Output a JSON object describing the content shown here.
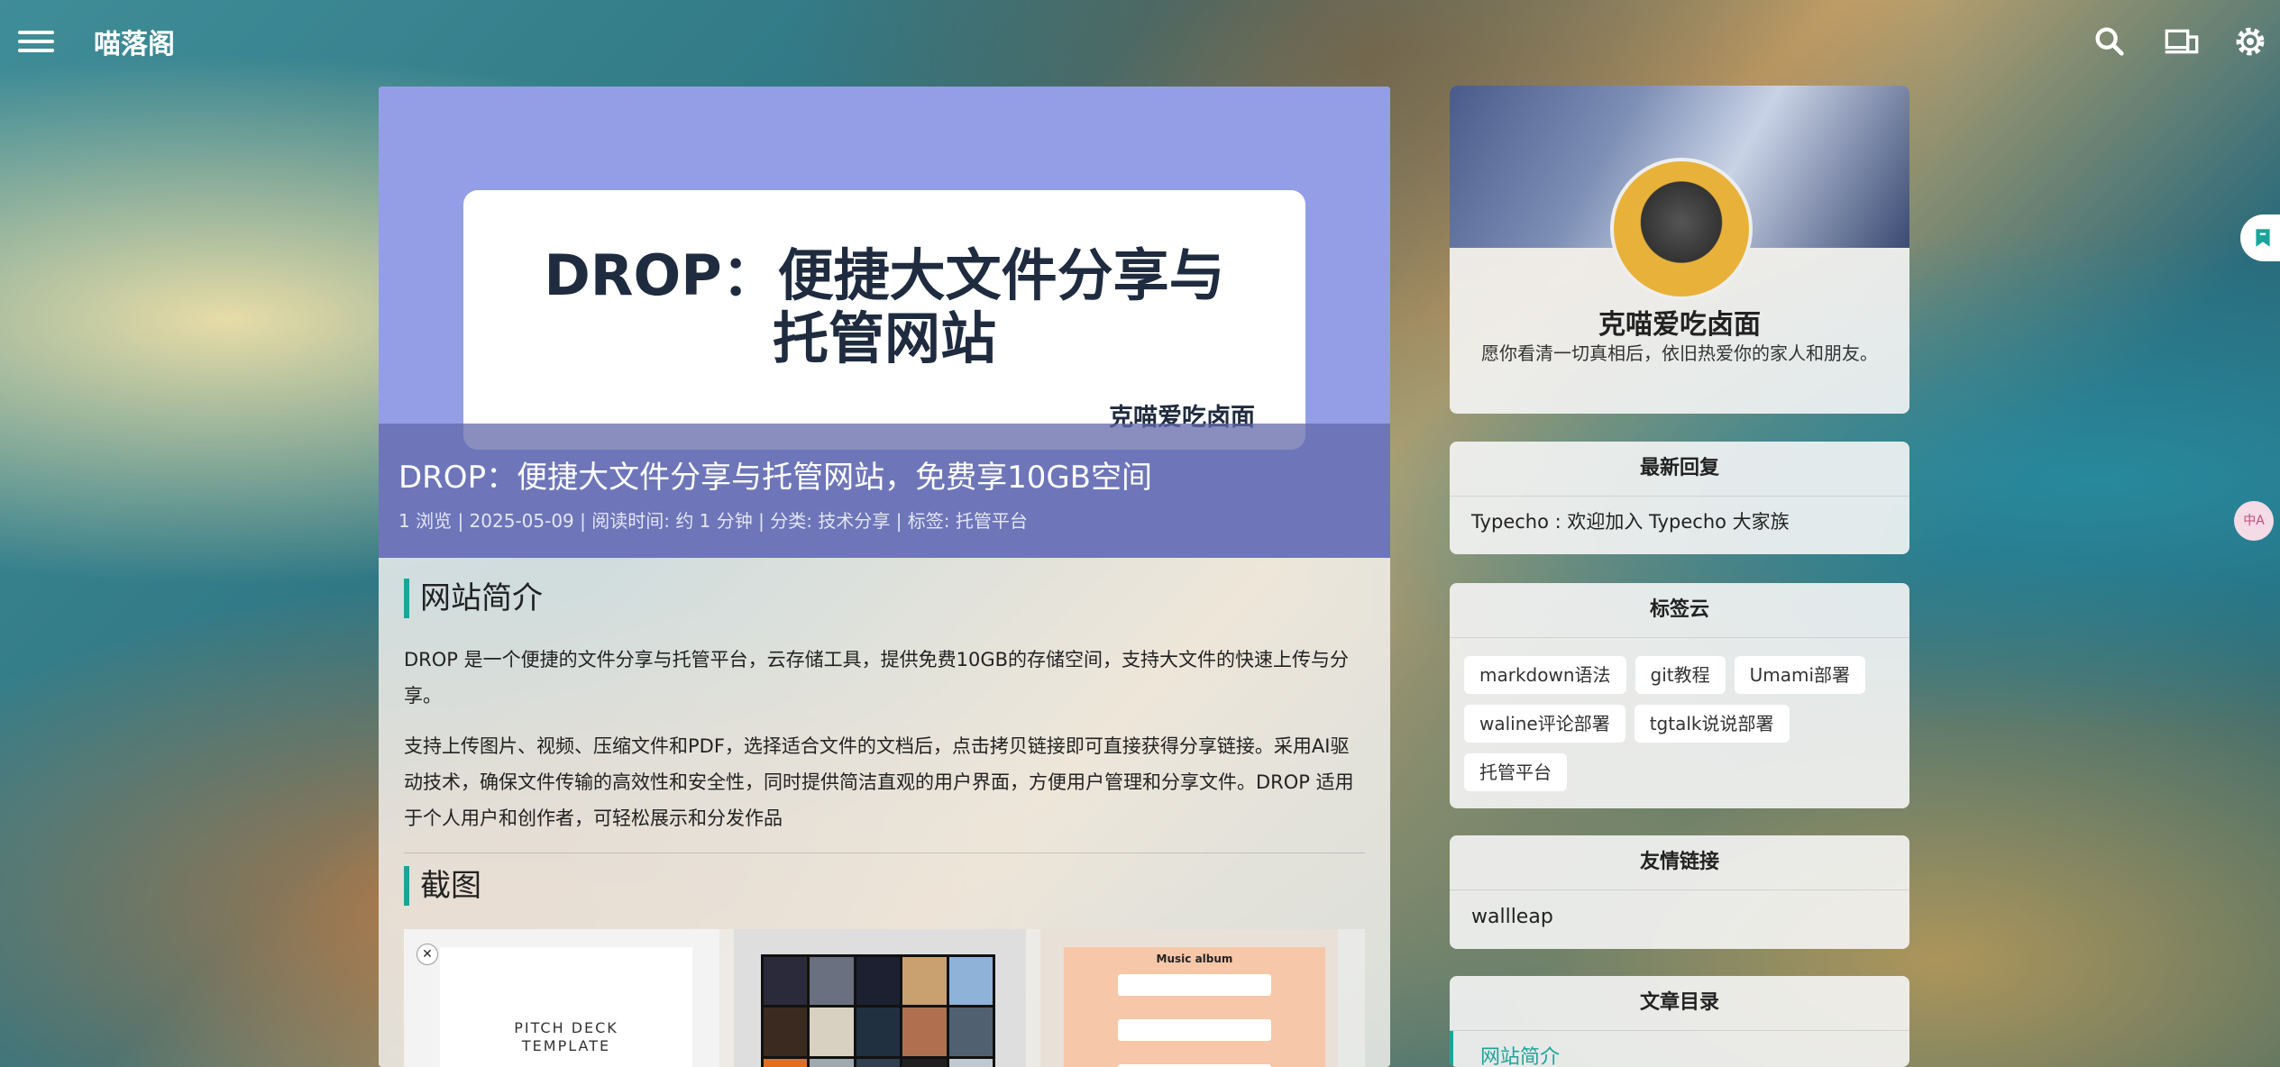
{
  "header": {
    "site_title": "喵落阁"
  },
  "post": {
    "cover_heading_line1": "DROP：便捷大文件分享与",
    "cover_heading_line2": "托管网站",
    "cover_author": "克喵爱吃卤面",
    "title": "DROP：便捷大文件分享与托管网站，免费享10GB空间",
    "meta": {
      "views": "1 浏览",
      "date": "2025-05-09",
      "read_time": "阅读时间: 约 1 分钟",
      "category": "分类: 技术分享",
      "tags": "标签: 托管平台",
      "separator": " | "
    },
    "sections": [
      {
        "heading": "网站简介",
        "paragraphs": [
          "DROP 是一个便捷的文件分享与托管平台，云存储工具，提供免费10GB的存储空间，支持大文件的快速上传与分享。",
          "支持上传图片、视频、压缩文件和PDF，选择适合文件的文档后，点击拷贝链接即可直接获得分享链接。采用AI驱动技术，确保文件传输的高效性和安全性，同时提供简洁直观的用户界面，方便用户管理和分享文件。DROP 适用于个人用户和创作者，可轻松展示和分发作品"
        ]
      },
      {
        "heading": "截图"
      }
    ],
    "screenshots": {
      "pitch_line1": "PITCH DECK",
      "pitch_line2": "TEMPLATE",
      "close_glyph": "✕",
      "music_title": "Music album"
    }
  },
  "sidebar": {
    "author_name": "克喵爱吃卤面",
    "author_bio": "愿你看清一切真相后，依旧热爱你的家人和朋友。",
    "recent": {
      "title": "最新回复",
      "items": [
        "Typecho : 欢迎加入 Typecho 大家族"
      ]
    },
    "tags": {
      "title": "标签云",
      "items": [
        "markdown语法",
        "git教程",
        "Umami部署",
        "waline评论部署",
        "tgtalk说说部署",
        "托管平台"
      ]
    },
    "links": {
      "title": "友情链接",
      "items": [
        "wallleap"
      ]
    },
    "toc": {
      "title": "文章目录",
      "items": [
        "网站简介"
      ]
    }
  },
  "floating": {
    "translate_label": "中A"
  },
  "icons": {
    "menu": "menu-icon",
    "search": "search-icon",
    "devices": "devices-icon",
    "settings": "gear-icon",
    "bookmark": "bookmark-icon",
    "translate": "translate-icon"
  },
  "colors": {
    "accent": "#1aa59a",
    "hero_bg": "#939ee6",
    "hero_overlay": "#6268aa"
  }
}
